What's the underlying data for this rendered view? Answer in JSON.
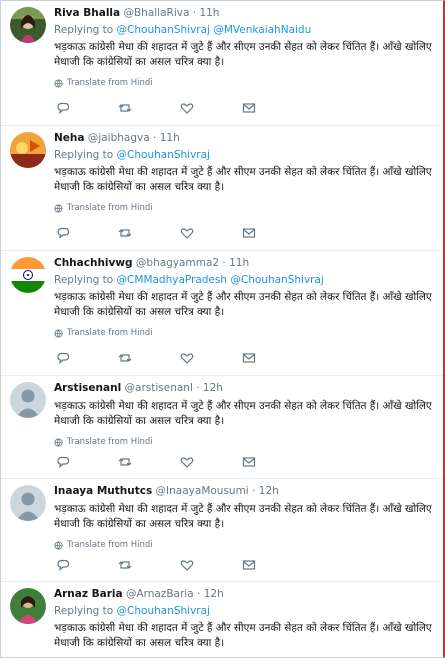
{
  "tweets": [
    {
      "name": "Riva Bhalla",
      "handle": "@BhallaRiva",
      "time": "11h",
      "replying_label": "Replying to",
      "mentions": [
        "@ChouhanShivraj",
        "@MVenkaiahNaidu"
      ],
      "text": "भड़काऊ कांग्रेसी मेधा की शहादत में जुटे हैं और सीएम उनकी सेहत को लेकर चिंतित हैं। आँखे खोलिए मेधाजी कि कांग्रेसियों का असल चरित्र क्या है।",
      "translate": "Translate from Hindi",
      "avatar_colors": [
        "#3b5b2f",
        "#e1c3a6"
      ]
    },
    {
      "name": "Neha",
      "handle": "@jaibhagva",
      "time": "11h",
      "replying_label": "Replying to",
      "mentions": [
        "@ChouhanShivraj"
      ],
      "text": "भड़काऊ कांग्रेसी मेधा की शहादत में जुटे हैं और सीएम उनकी सेहत को लेकर चिंतित हैं। आँखे खोलिए मेधाजी कि कांग्रेसियों का असल चरित्र क्या है।",
      "translate": "Translate from Hindi",
      "avatar_colors": [
        "#f2a23a",
        "#8b2b16"
      ]
    },
    {
      "name": "Chhachhivwg",
      "handle": "@bhagyamma2",
      "time": "11h",
      "replying_label": "Replying to",
      "mentions": [
        "@CMMadhyaPradesh",
        "@ChouhanShivraj"
      ],
      "text": "भड़काऊ कांग्रेसी मेधा की शहादत में जुटे हैं और सीएम उनकी सेहत को लेकर चिंतित हैं। आँखे खोलिए मेधाजी कि कांग्रेसियों का असल चरित्र क्या है।",
      "translate": "Translate from Hindi",
      "avatar_colors": [
        "#ff9933",
        "#ffffff",
        "#138808",
        "#000080"
      ]
    },
    {
      "name": "Arstisenanl",
      "handle": "@arstisenanl",
      "time": "12h",
      "replying_label": "Replying to",
      "mentions": [
        "@ChouhanShivraj"
      ],
      "text": "भड़काऊ कांग्रेसी मेधा की शहादत में जुटे हैं और सीएम उनकी सेहत को लेकर चिंतित हैं। आँखे खोलिए मेधाजी कि कांग्रेसियों का असल चरित्र क्या है।",
      "translate": "Translate from Hindi",
      "avatar_colors": [
        "#ccd6dd",
        "#8899a6"
      ]
    },
    {
      "name": "Inaaya Muthutcs",
      "handle": "@InaayaMousumi",
      "time": "12h",
      "replying_label": "Replying to",
      "mentions": [
        "@ChouhanShivraj"
      ],
      "text": "भड़काऊ कांग्रेसी मेधा की शहादत में जुटे हैं और सीएम उनकी सेहत को लेकर चिंतित हैं। आँखे खोलिए मेधाजी कि कांग्रेसियों का असल चरित्र क्या है।",
      "translate": "Translate from Hindi",
      "avatar_colors": [
        "#ccd6dd",
        "#8899a6"
      ]
    },
    {
      "name": "Arnaz Baria",
      "handle": "@ArnazBaria",
      "time": "12h",
      "replying_label": "Replying to",
      "mentions": [
        "@ChouhanShivraj"
      ],
      "text": "भड़काऊ कांग्रेसी मेधा की शहादत में जुटे हैं और सीएम उनकी सेहत को लेकर चिंतित हैं। आँखे खोलिए मेधाजी कि कांग्रेसियों का असल चरित्र क्या है।",
      "translate": "Translate from Hindi",
      "avatar_colors": [
        "#3f7f3a",
        "#d6447a"
      ]
    }
  ],
  "colors": {
    "link": "#1b95e0",
    "muted": "#657786",
    "divider": "#e6ecf0",
    "icon": "#657786"
  },
  "icons": [
    "reply-icon",
    "retweet-icon",
    "like-icon",
    "direct-message-icon",
    "globe-icon"
  ]
}
